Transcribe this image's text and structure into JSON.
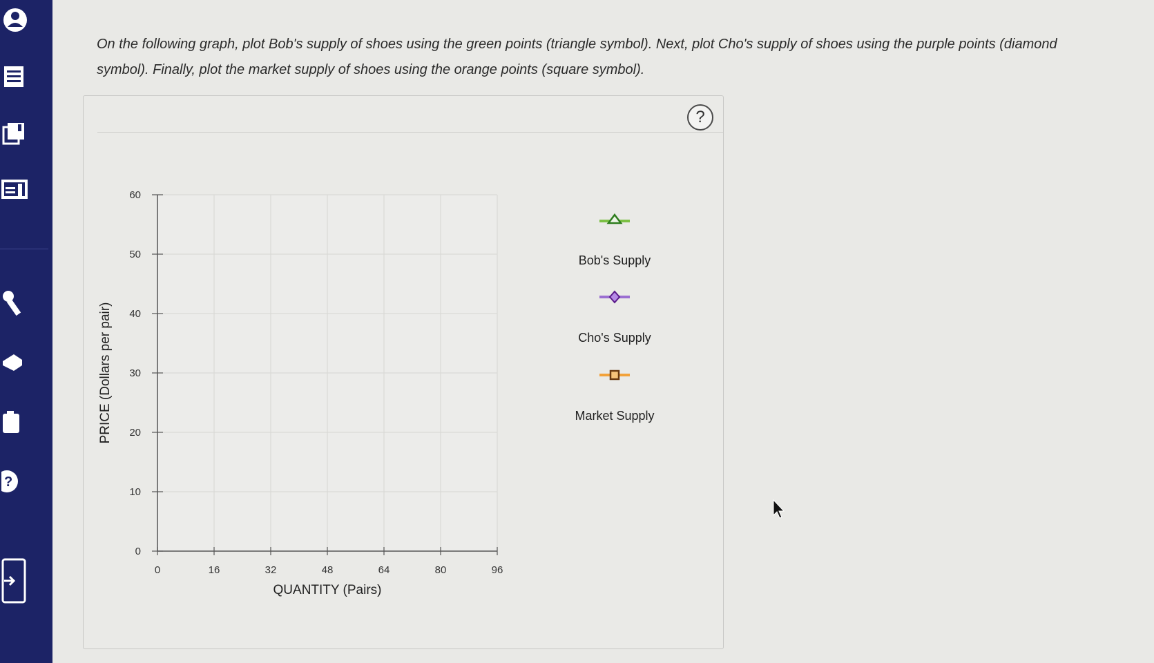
{
  "sidebar": {
    "icons": [
      "user-icon",
      "list-icon",
      "library-icon",
      "gradebook-icon",
      "tools-icon",
      "graduation-icon",
      "briefcase-icon",
      "help-icon",
      "logout-icon"
    ]
  },
  "instructions": "On the following graph, plot Bob's supply of shoes using the green points (triangle symbol). Next, plot Cho's supply of shoes using the purple points (diamond symbol). Finally, plot the market supply of shoes using the orange points (square symbol).",
  "help": {
    "label": "?"
  },
  "legend": [
    {
      "label": "Bob's Supply",
      "symbol": "triangle",
      "color": "#2e7d1e",
      "line_color": "#7cc044"
    },
    {
      "label": "Cho's Supply",
      "symbol": "diamond",
      "color": "#5a1a8a",
      "line_color": "#9b6fd1"
    },
    {
      "label": "Market Supply",
      "symbol": "square",
      "color": "#6a3a10",
      "line_color": "#f2a23a"
    }
  ],
  "chart_data": {
    "type": "scatter",
    "title": "",
    "xlabel": "QUANTITY (Pairs)",
    "ylabel": "PRICE (Dollars per pair)",
    "xlim": [
      0,
      96
    ],
    "ylim": [
      0,
      60
    ],
    "xticks": [
      0,
      16,
      32,
      48,
      64,
      80,
      96
    ],
    "yticks": [
      0,
      10,
      20,
      30,
      40,
      50,
      60
    ],
    "grid": true,
    "series": []
  },
  "colors": {
    "sidebar": "#1c2366",
    "grid": "#d6d6d3",
    "axis": "#555555"
  }
}
